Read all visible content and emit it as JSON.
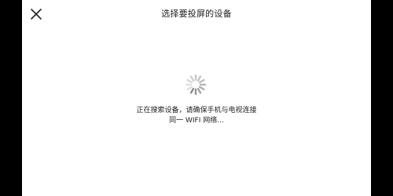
{
  "header": {
    "title": "选择要投屏的设备",
    "close_icon": "close-icon"
  },
  "status": {
    "spinner_icon": "loading-spinner-icon",
    "line1": "正在搜索设备，请确保手机与电视连接",
    "line2": "同一 WIFI 网络..."
  }
}
